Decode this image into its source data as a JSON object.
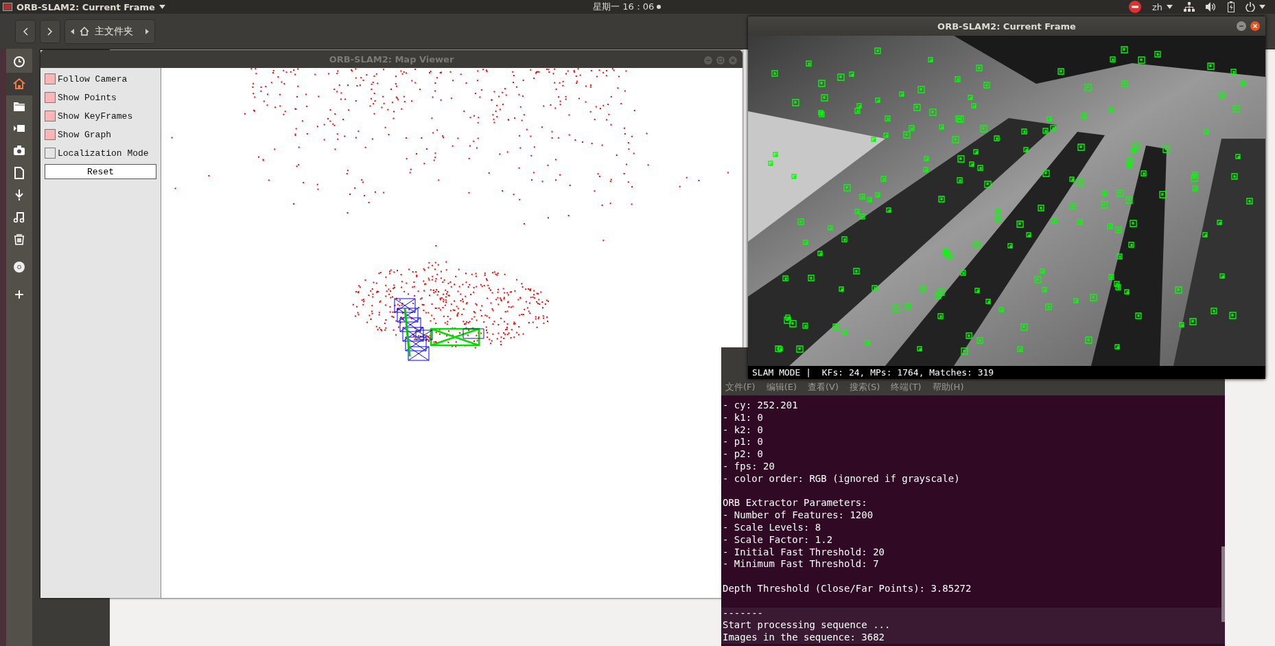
{
  "top_bar": {
    "app_title": "ORB-SLAM2: Current Frame",
    "clock": "星期一 16：06",
    "language": "zh"
  },
  "file_manager": {
    "location": "主文件夹"
  },
  "map_viewer": {
    "title": "ORB-SLAM2: Map Viewer",
    "options": [
      {
        "label": "Follow Camera",
        "checked": true
      },
      {
        "label": "Show Points",
        "checked": true
      },
      {
        "label": "Show KeyFrames",
        "checked": true
      },
      {
        "label": "Show Graph",
        "checked": true
      },
      {
        "label": "Localization Mode",
        "checked": false
      }
    ],
    "reset_button": "Reset"
  },
  "current_frame": {
    "title": "ORB-SLAM2: Current Frame",
    "status": "SLAM MODE |  KFs: 24, MPs: 1764, Matches: 319"
  },
  "terminal": {
    "menu": [
      "文件(F)",
      "编辑(E)",
      "查看(V)",
      "搜索(S)",
      "终端(T)",
      "帮助(H)"
    ],
    "blocks": [
      [
        "- cy: 252.201",
        "- k1: 0",
        "- k2: 0",
        "- p1: 0",
        "- p2: 0",
        "- fps: 20",
        "- color order: RGB (ignored if grayscale)"
      ],
      [
        "ORB Extractor Parameters:",
        "- Number of Features: 1200",
        "- Scale Levels: 8",
        "- Scale Factor: 1.2",
        "- Initial Fast Threshold: 20",
        "- Minimum Fast Threshold: 7"
      ],
      [
        "Depth Threshold (Close/Far Points): 3.85272"
      ],
      [
        "-------",
        "Start processing sequence ...",
        "Images in the sequence: 3682"
      ]
    ]
  }
}
